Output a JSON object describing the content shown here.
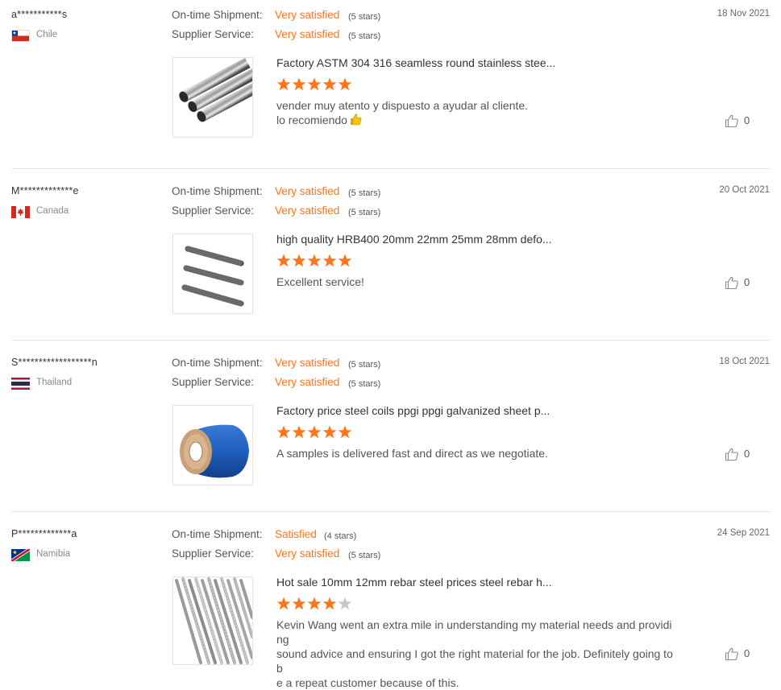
{
  "labels": {
    "shipment": "On-time Shipment:",
    "service": "Supplier Service:"
  },
  "colors": {
    "accent": "#ff7519",
    "star_empty": "#c8c8c8",
    "divider": "#e6e6e6"
  },
  "reviews": [
    {
      "user": "a***********s",
      "country": "Chile",
      "flag_icon": "chile-flag-icon",
      "date": "18 Nov 2021",
      "shipment_value": "Very satisfied",
      "shipment_stars": "(5 stars)",
      "service_value": "Very satisfied",
      "service_stars": "(5 stars)",
      "product_title": "Factory ASTM 304 316 seamless round stainless stee...",
      "product_image": "stainless-steel-pipes-image",
      "rating": 5,
      "comment_lines": [
        "vender muy atento y dispuesto a ayudar al cliente.",
        "lo recomiendo"
      ],
      "comment_emoji": "thumbs-up-emoji",
      "likes": "0"
    },
    {
      "user": "M*************e",
      "country": "Canada",
      "flag_icon": "canada-flag-icon",
      "date": "20 Oct 2021",
      "shipment_value": "Very satisfied",
      "shipment_stars": "(5 stars)",
      "service_value": "Very satisfied",
      "service_stars": "(5 stars)",
      "product_title": "high quality HRB400 20mm 22mm 25mm 28mm defo...",
      "product_image": "rebar-bars-image",
      "rating": 5,
      "comment_lines": [
        "Excellent service!"
      ],
      "likes": "0"
    },
    {
      "user": "S******************n",
      "country": "Thailand",
      "flag_icon": "thailand-flag-icon",
      "date": "18 Oct 2021",
      "shipment_value": "Very satisfied",
      "shipment_stars": "(5 stars)",
      "service_value": "Very satisfied",
      "service_stars": "(5 stars)",
      "product_title": "Factory price steel coils ppgi ppgi galvanized sheet p...",
      "product_image": "blue-steel-coil-image",
      "rating": 5,
      "comment_lines": [
        "A samples is delivered fast and direct as we negotiate."
      ],
      "likes": "0"
    },
    {
      "user": "P*************a",
      "country": "Namibia",
      "flag_icon": "namibia-flag-icon",
      "date": "24 Sep 2021",
      "shipment_value": "Satisfied",
      "shipment_stars": "(4 stars)",
      "service_value": "Very satisfied",
      "service_stars": "(5 stars)",
      "product_title": "Hot sale 10mm 12mm rebar steel prices steel rebar h...",
      "product_image": "rebar-bundle-image",
      "rating": 4,
      "comment_lines": [
        "Kevin Wang went an extra mile in understanding my material needs and providing",
        "sound advice and ensuring I got the right material for the job. Definitely going to b",
        "e a repeat customer because of this."
      ],
      "likes": "0"
    }
  ]
}
